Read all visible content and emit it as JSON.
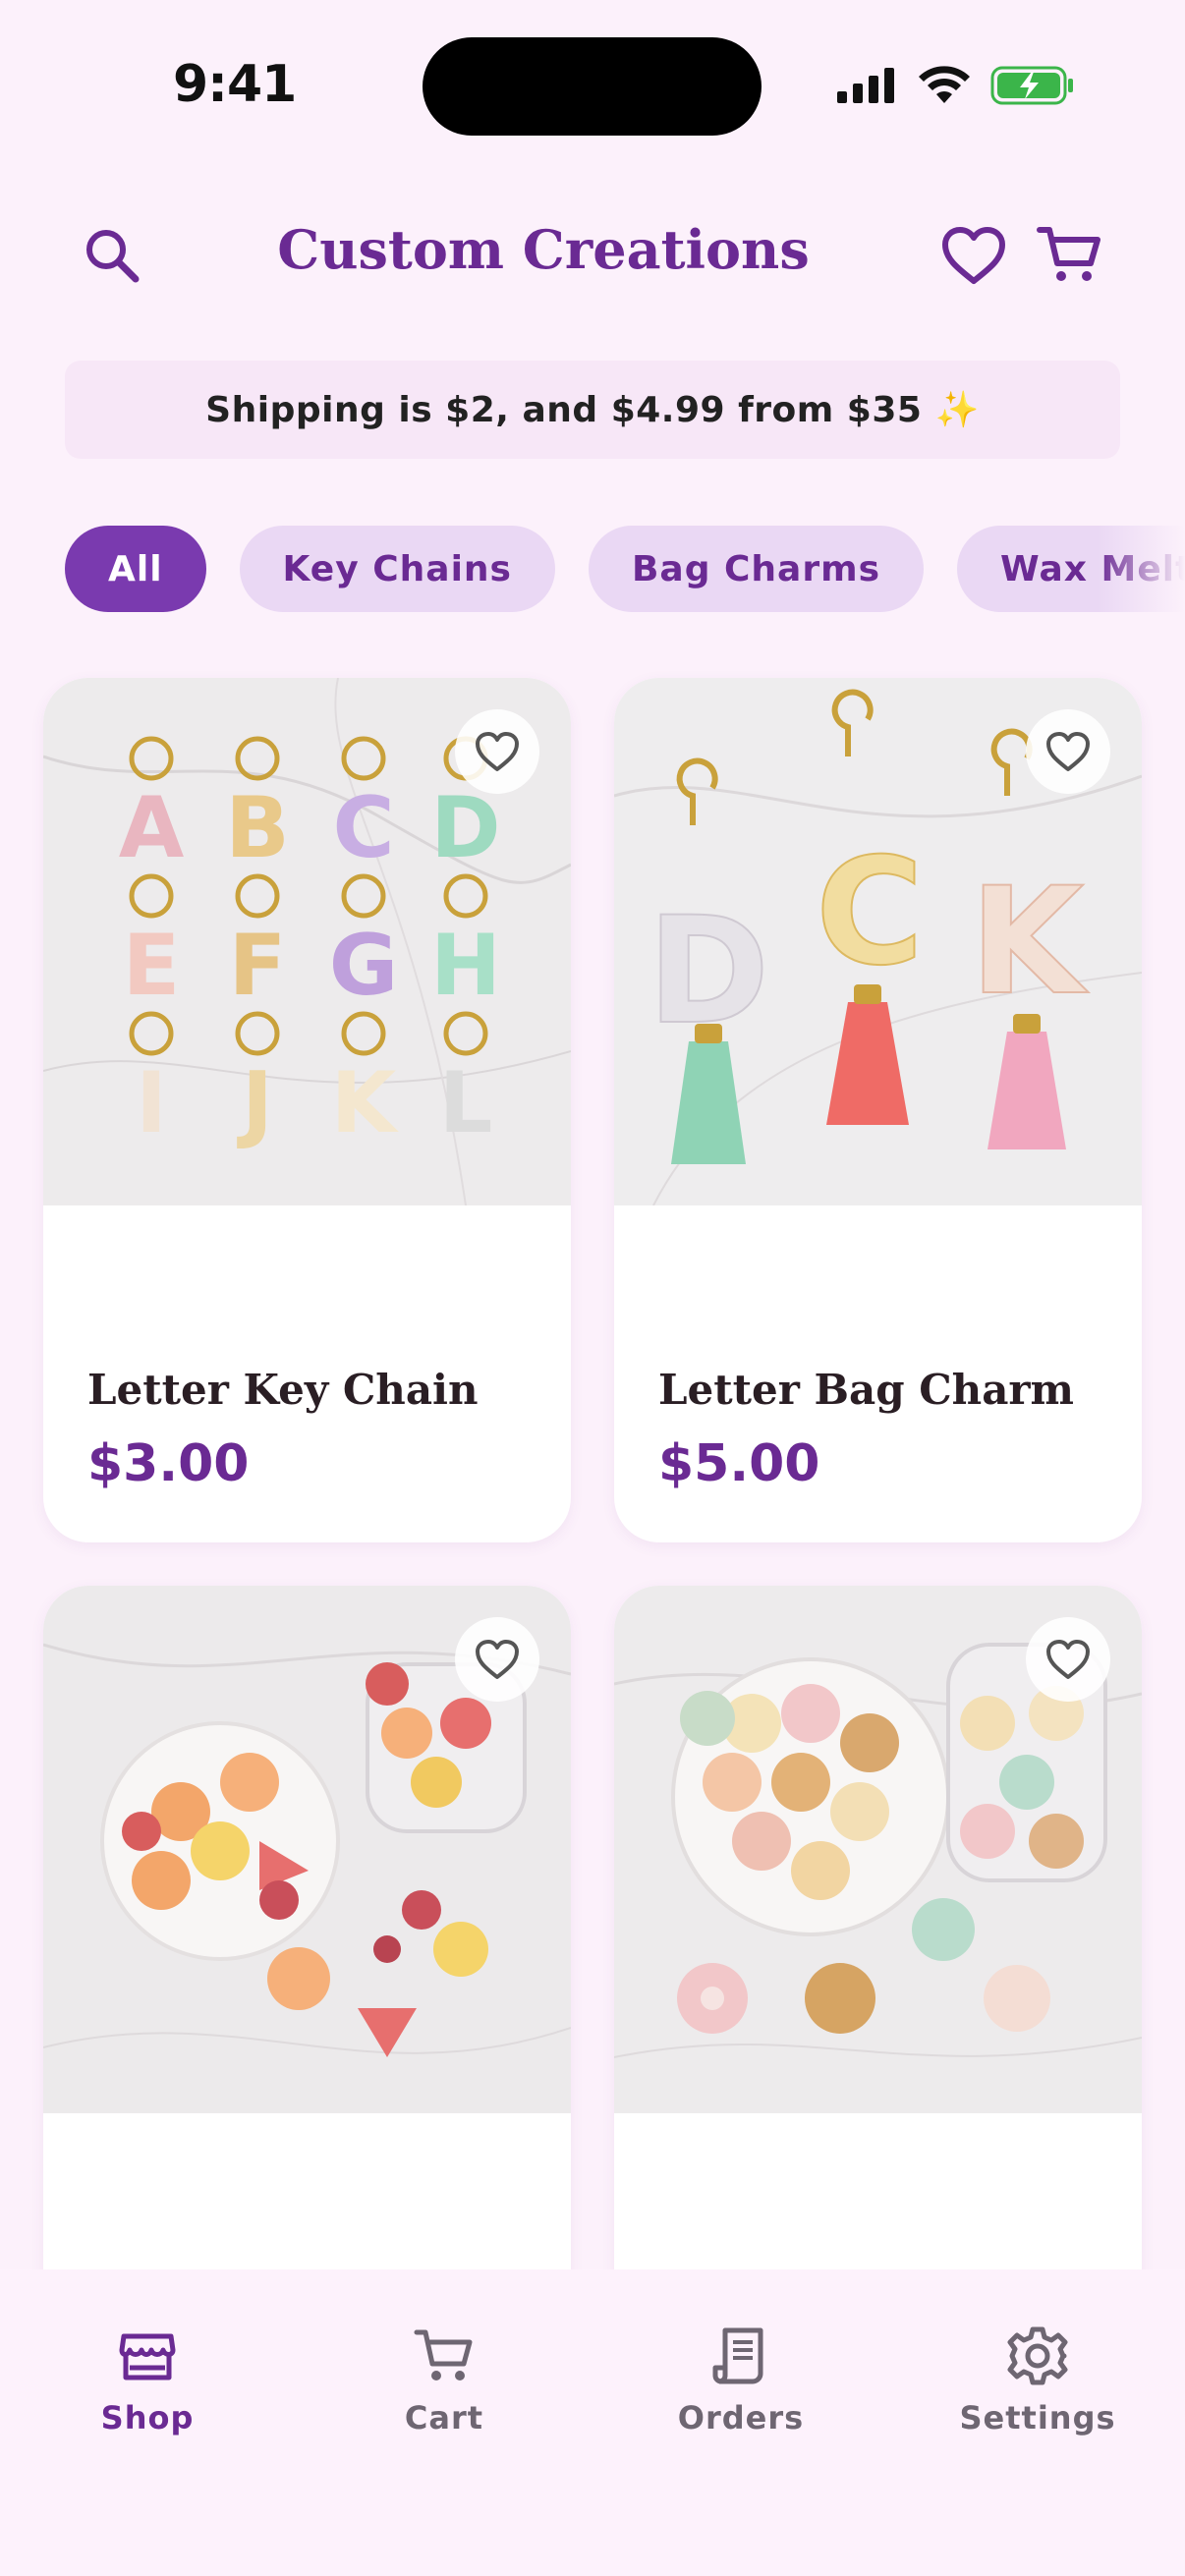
{
  "status_bar": {
    "time": "9:41"
  },
  "header": {
    "title": "Custom Creations"
  },
  "banner": {
    "text": "Shipping is $2, and $4.99 from $35 ✨"
  },
  "categories": [
    {
      "label": "All",
      "active": true
    },
    {
      "label": "Key Chains",
      "active": false
    },
    {
      "label": "Bag Charms",
      "active": false
    },
    {
      "label": "Wax Melts",
      "active": false
    }
  ],
  "products": [
    {
      "name": "Letter Key Chain",
      "price": "$3.00"
    },
    {
      "name": "Letter Bag Charm",
      "price": "$5.00"
    },
    {
      "name": "",
      "price": ""
    },
    {
      "name": "",
      "price": ""
    }
  ],
  "tabbar": {
    "items": [
      {
        "label": "Shop",
        "icon": "store-icon",
        "active": true
      },
      {
        "label": "Cart",
        "icon": "cart-icon",
        "active": false
      },
      {
        "label": "Orders",
        "icon": "receipt-icon",
        "active": false
      },
      {
        "label": "Settings",
        "icon": "gear-icon",
        "active": false
      }
    ]
  },
  "colors": {
    "accent": "#6A2A93",
    "chip_bg": "#EAD8F4",
    "page_bg": "#FCF1FB"
  }
}
